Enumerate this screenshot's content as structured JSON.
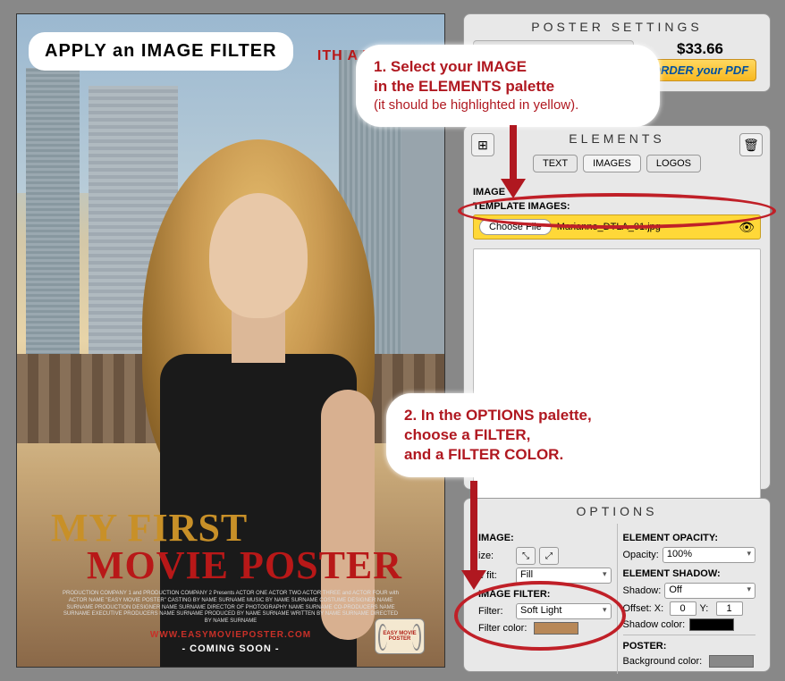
{
  "tutorial": {
    "header": "APPLY an IMAGE FILTER",
    "step1_line1": "1. Select your IMAGE",
    "step1_line2": "in the ELEMENTS palette",
    "step1_line3": "(it should be highlighted in yellow).",
    "step2_line1": "2. In the OPTIONS palette,",
    "step2_line2": "choose a FILTER,",
    "step2_line3": "and a FILTER COLOR."
  },
  "poster": {
    "tagline": "ITH A TWIST!",
    "title1": "MY FIRST",
    "title2": "MOVIE POSTER",
    "credits": "PRODUCTION COMPANY 1 and PRODUCTION COMPANY 2 Presents ACTOR ONE ACTOR TWO ACTOR THREE and ACTOR FOUR with ACTOR NAME \"EASY MOVIE POSTER\" CASTING BY NAME SURNAME MUSIC BY NAME SURNAME COSTUME DESIGNER NAME SURNAME PRODUCTION DESIGNER NAME SURNAME DIRECTOR OF PHOTOGRAPHY NAME SURNAME CO-PRODUCERS NAME SURNAME EXECUTIVE PRODUCERS NAME SURNAME PRODUCED BY NAME SURNAME WRITTEN BY NAME SURNAME DIRECTED BY NAME SURNAME",
    "url": "WWW.EASYMOVIEPOSTER.COM",
    "coming": "- COMING SOON -",
    "badge": "EASY MOVIE POSTER"
  },
  "settings": {
    "title": "POSTER SETTINGS",
    "price": "$33.66",
    "order_label": "ORDER your ",
    "order_pdf": "PDF"
  },
  "elements": {
    "title": "ELEMENTS",
    "tabs": {
      "text": "TEXT",
      "images": "IMAGES",
      "logos": "LOGOS"
    },
    "image_label": "IMAGE",
    "template_label": "TEMPLATE IMAGES:",
    "choose_file": "Choose File",
    "filename": "Marianne_DTLA_01.jpg"
  },
  "options": {
    "title": "OPTIONS",
    "image_h": "IMAGE:",
    "size_label": "ize:",
    "fit_label": "e fit:",
    "fit_value": "Fill",
    "filter_h": "IMAGE FILTER:",
    "filter_label": "Filter:",
    "filter_value": "Soft Light",
    "filter_color_label": "Filter color:",
    "opacity_h": "ELEMENT OPACITY:",
    "opacity_label": "Opacity:",
    "opacity_value": "100%",
    "shadow_h": "ELEMENT SHADOW:",
    "shadow_label": "Shadow:",
    "shadow_value": "Off",
    "offset_x_label": "Offset: X:",
    "offset_x": "0",
    "offset_y_label": "Y:",
    "offset_y": "1",
    "shadow_color_label": "Shadow color:",
    "poster_h": "POSTER:",
    "bg_color_label": "Background color:"
  }
}
